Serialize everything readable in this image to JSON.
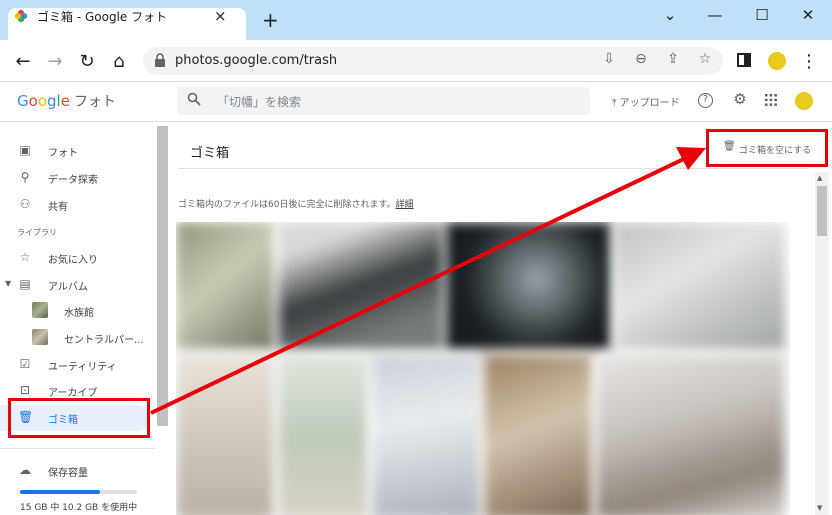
{
  "browser": {
    "tab_title": "ゴミ箱 - Google フォト",
    "tab_close_icon": "×",
    "new_tab_icon": "+",
    "window_controls": {
      "collapse": "⌄",
      "minimize": "—",
      "maximize": "☐",
      "close": "✕"
    },
    "nav": {
      "back": "←",
      "forward": "→",
      "reload": "↻",
      "home": "⌂"
    },
    "url": "photos.google.com/trash",
    "omnibox_icons": [
      "install-icon",
      "zoom-icon",
      "share-icon",
      "bookmark-star-icon"
    ],
    "menu_icon": "⋮"
  },
  "app_header": {
    "logo": {
      "g": "G",
      "o1": "o",
      "o2": "o",
      "g2": "g",
      "l": "l",
      "e": "e"
    },
    "product": "フォト",
    "search_icon": "🔍",
    "search_placeholder": "「切幡」を検索",
    "upload_label": "⤒ アップロード",
    "help_icon": "?",
    "settings_icon": "⚙",
    "apps_icon": "⋮⋮⋮"
  },
  "sidebar": {
    "items": [
      {
        "label": "フォト",
        "icon": "photo-icon"
      },
      {
        "label": "データ探索",
        "icon": "search-icon"
      },
      {
        "label": "共有",
        "icon": "people-icon"
      }
    ],
    "library_label": "ライブラリ",
    "library_items": [
      {
        "label": "お気に入り",
        "icon": "star-icon"
      },
      {
        "label": "アルバム",
        "icon": "album-icon"
      }
    ],
    "albums": [
      {
        "label": "水族館"
      },
      {
        "label": "セントラルパー..."
      }
    ],
    "more_items": [
      {
        "label": "ユーティリティ",
        "icon": "utilities-icon"
      },
      {
        "label": "アーカイブ",
        "icon": "archive-icon"
      },
      {
        "label": "ゴミ箱",
        "icon": "trash-icon"
      }
    ],
    "storage_label": "保存容量",
    "storage_text": "15 GB 中 10.2 GB を使用中",
    "storage_fraction": 0.68
  },
  "main": {
    "title": "ゴミ箱",
    "empty_trash_label": "ゴミ箱を空にする",
    "notice": "ゴミ箱内のファイルは60日後に完全に削除されます。",
    "notice_link": "詳細"
  },
  "colors": {
    "accent": "#1a73e8",
    "annotation_red": "#e8000b",
    "tabstrip": "#bfe0f6"
  }
}
